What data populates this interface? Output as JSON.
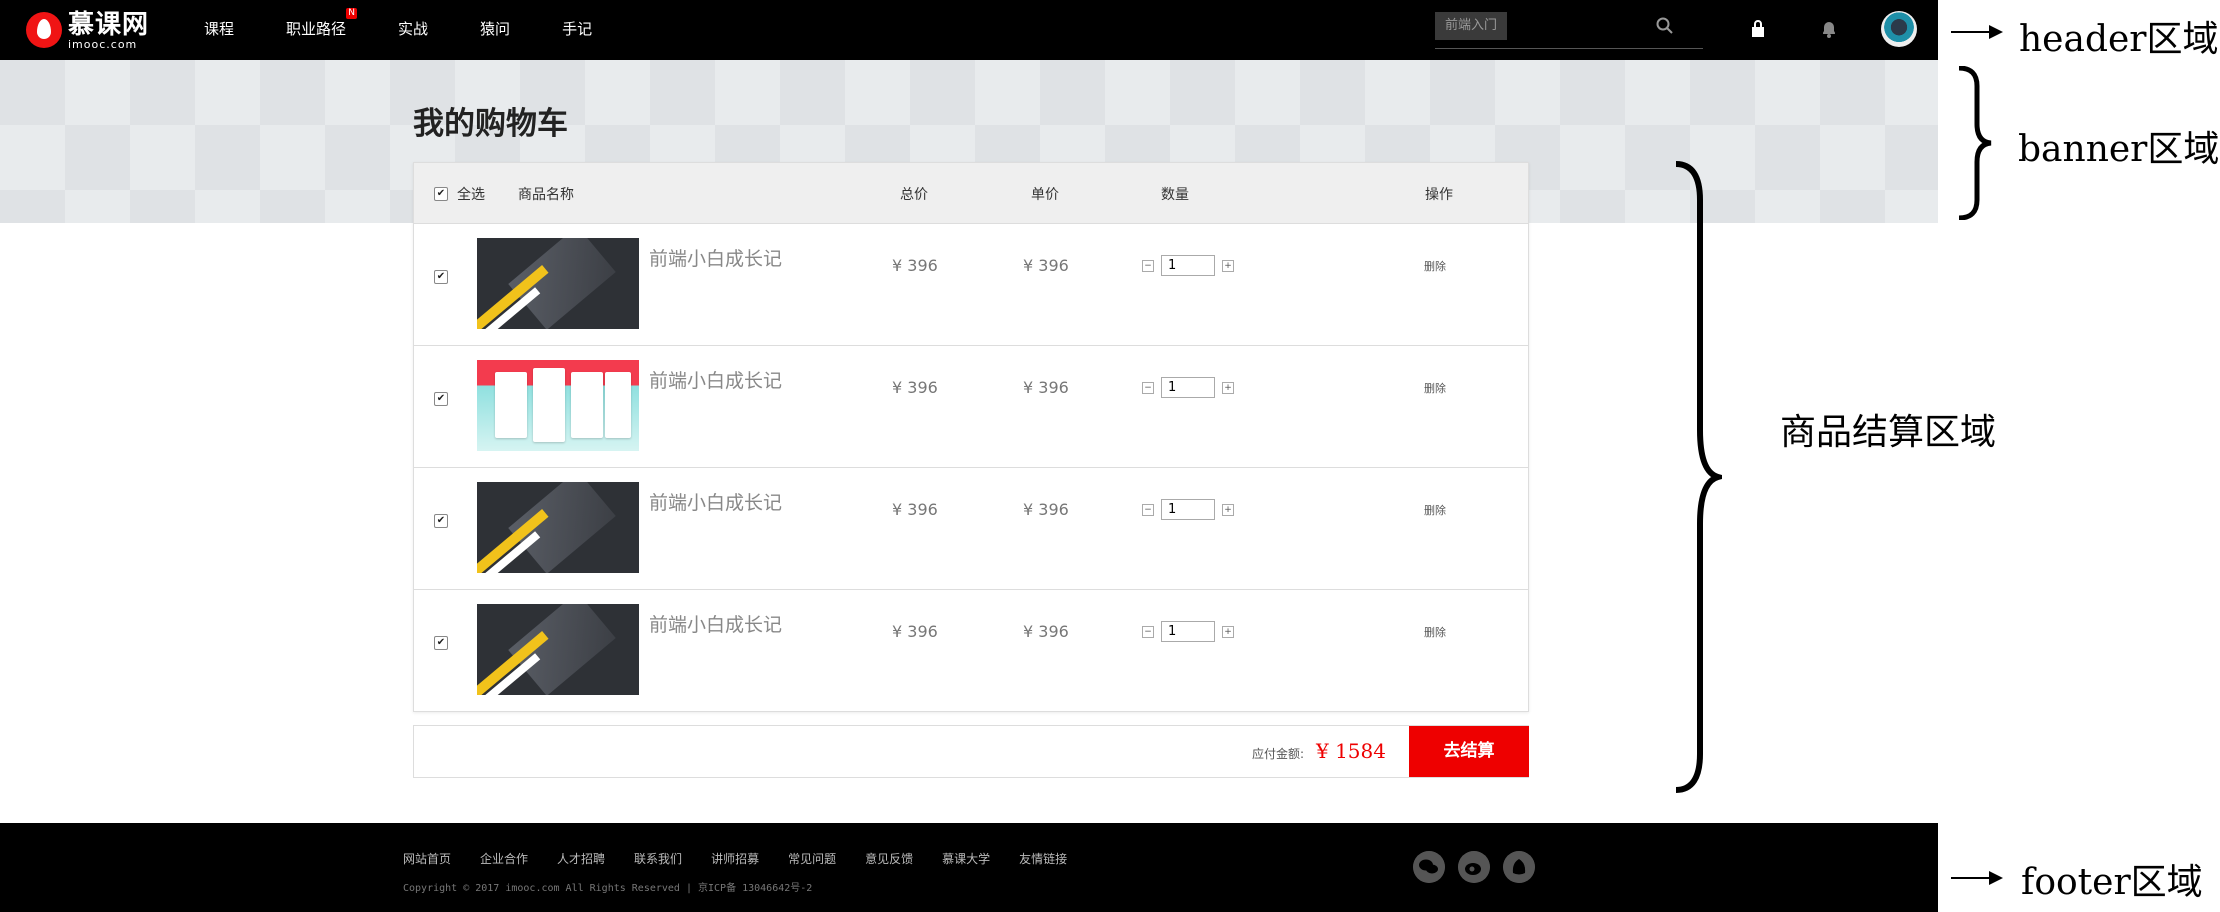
{
  "header": {
    "logo_cn": "慕课网",
    "logo_en": "imooc.com",
    "nav": [
      {
        "label": "课程"
      },
      {
        "label": "职业路径",
        "badge": "N"
      },
      {
        "label": "实战"
      },
      {
        "label": "猿问"
      },
      {
        "label": "手记"
      }
    ],
    "search_tag": "前端入门"
  },
  "banner": {
    "title": "我的购物车"
  },
  "cart": {
    "headers": {
      "select_all": "全选",
      "name": "商品名称",
      "total": "总价",
      "unit": "单价",
      "qty": "数量",
      "action": "操作"
    },
    "items": [
      {
        "name": "前端小白成长记",
        "total": "¥ 396",
        "unit": "¥ 396",
        "qty": "1",
        "delete": "删除",
        "thumb": "dark"
      },
      {
        "name": "前端小白成长记",
        "total": "¥ 396",
        "unit": "¥ 396",
        "qty": "1",
        "delete": "删除",
        "thumb": "red"
      },
      {
        "name": "前端小白成长记",
        "total": "¥ 396",
        "unit": "¥ 396",
        "qty": "1",
        "delete": "删除",
        "thumb": "dark"
      },
      {
        "name": "前端小白成长记",
        "total": "¥ 396",
        "unit": "¥ 396",
        "qty": "1",
        "delete": "删除",
        "thumb": "dark"
      }
    ],
    "qty_minus": "−",
    "qty_plus": "+",
    "check_mark": "✔"
  },
  "checkout": {
    "label": "应付金额:",
    "amount": "¥ 1584",
    "button": "去结算"
  },
  "footer": {
    "links": [
      "网站首页",
      "企业合作",
      "人才招聘",
      "联系我们",
      "讲师招募",
      "常见问题",
      "意见反馈",
      "慕课大学",
      "友情链接"
    ],
    "copyright": "Copyright © 2017 imooc.com All Rights Reserved | 京ICP备 13046642号-2"
  },
  "annotations": {
    "header": "header区域",
    "banner": "banner区域",
    "goods": "商品结算区域",
    "footer": "footer区域"
  },
  "colors": {
    "accent": "#ee0000",
    "header_bg": "#000000",
    "banner_bg": "#dfe2e5"
  }
}
